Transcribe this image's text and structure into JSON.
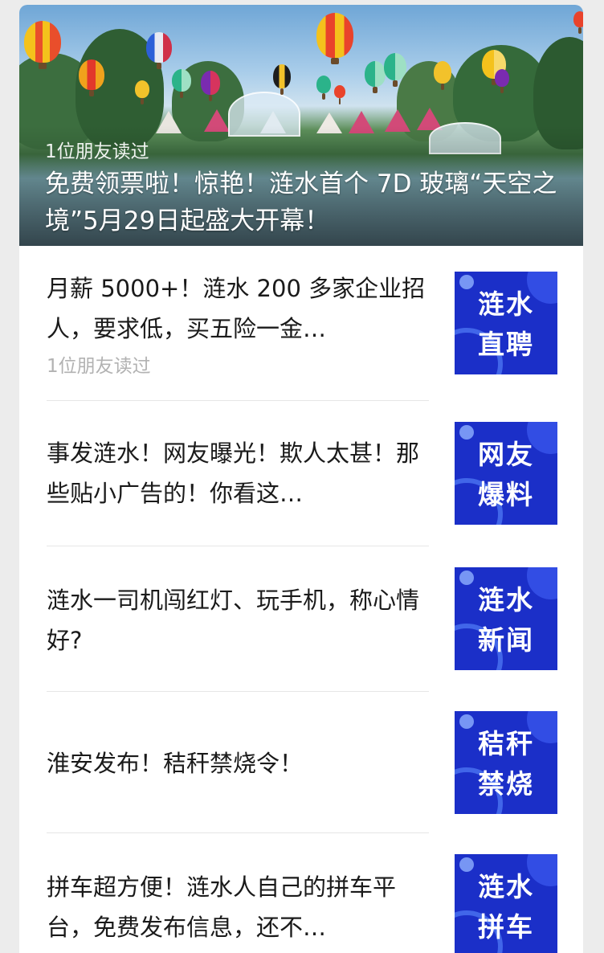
{
  "hero": {
    "read_by": "1位朋友读过",
    "title": "免费领票啦！惊艳！涟水首个 7D 玻璃“天空之境”5月29日起盛大开幕！"
  },
  "articles": [
    {
      "title": "月薪 5000+！涟水 200 多家企业招人，要求低，买五险一金…",
      "read_by": "1位朋友读过",
      "thumb_line1": "涟水",
      "thumb_line2": "直聘"
    },
    {
      "title": "事发涟水！网友曝光！欺人太甚！那些贴小广告的！你看这…",
      "thumb_line1": "网友",
      "thumb_line2": "爆料"
    },
    {
      "title": "涟水一司机闯红灯、玩手机，称心情好?",
      "thumb_line1": "涟水",
      "thumb_line2": "新闻"
    },
    {
      "title": "淮安发布！秸秆禁烧令！",
      "thumb_line1": "秸秆",
      "thumb_line2": "禁烧"
    },
    {
      "title": "拼车超方便！涟水人自己的拼车平台，免费发布信息，还不…",
      "thumb_line1": "涟水",
      "thumb_line2": "拼车"
    }
  ],
  "colors": {
    "thumb_bg": "#1b2fc8",
    "read_text": "#b2b2b2"
  }
}
